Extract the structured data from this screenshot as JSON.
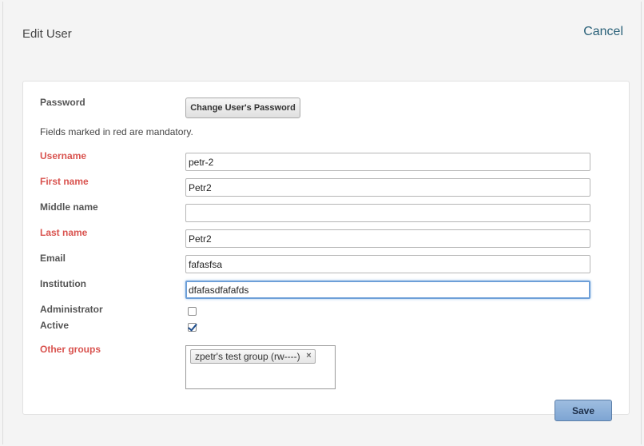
{
  "header": {
    "title": "Edit User",
    "cancel_label": "Cancel"
  },
  "form": {
    "password_label": "Password",
    "change_password_label": "Change User's Password",
    "mandatory_note": "Fields marked in red are mandatory.",
    "username": {
      "label": "Username",
      "value": "petr-2"
    },
    "first_name": {
      "label": "First name",
      "value": "Petr2"
    },
    "middle_name": {
      "label": "Middle name",
      "value": ""
    },
    "last_name": {
      "label": "Last name",
      "value": "Petr2"
    },
    "email": {
      "label": "Email",
      "value": "fafasfsa"
    },
    "institution": {
      "label": "Institution",
      "value": "dfafasdfafafds"
    },
    "administrator": {
      "label": "Administrator",
      "checked": false
    },
    "active": {
      "label": "Active",
      "checked": true
    },
    "other_groups": {
      "label": "Other groups",
      "items": [
        "zpetr's test group (rw----)"
      ],
      "remove_symbol": "×"
    },
    "save_label": "Save"
  },
  "colors": {
    "required_label": "#d9534f",
    "link": "#2a6179",
    "focus_border": "#6d9fd8",
    "save_button": "#7ea5d3"
  }
}
